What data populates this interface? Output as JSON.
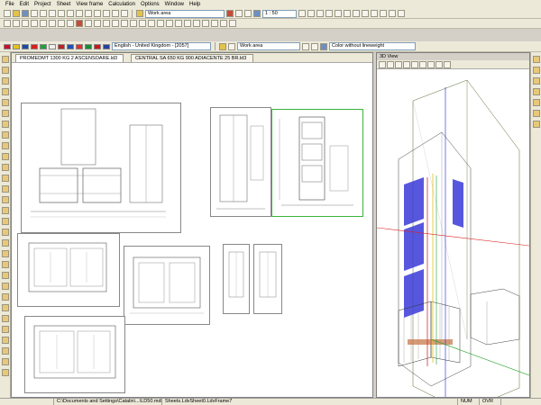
{
  "menu": [
    "File",
    "Edit",
    "Project",
    "Sheet",
    "View frame",
    "Calculation",
    "Options",
    "Window",
    "Help"
  ],
  "toolbar": {
    "work_area_1": "Work area",
    "zoom_scale": "1 : 50",
    "language": "English - United Kingdom - [2057]",
    "work_area_2": "Work area",
    "color_mode": "Color without lineweight"
  },
  "tabs": [
    {
      "label": "PROMEDMT 1300 KG 2 ASCENSOARE.ld3"
    },
    {
      "label": "CENTRAL SA 650 KG 900 ADIACENTE 25 BR.ld3"
    }
  ],
  "view3d": {
    "title": "3D View"
  },
  "status": {
    "path": "C:\\Documents and Settings\\Catalin\\...\\LD50.mdb",
    "sheet": "Sheets.LdvSheet0.LdvFrame7",
    "num": "NUM",
    "ovr": "OVR"
  },
  "colors": {
    "blue": "#3a3ad8",
    "selection": "#3ab43a",
    "axis_red": "#e02020",
    "axis_green": "#20a020",
    "axis_blue": "#2020e0"
  },
  "icons": [
    "search-icon",
    "zoom-in-icon",
    "zoom-out-icon",
    "save-icon",
    "print-icon",
    "flag-icon",
    "cube-icon"
  ]
}
